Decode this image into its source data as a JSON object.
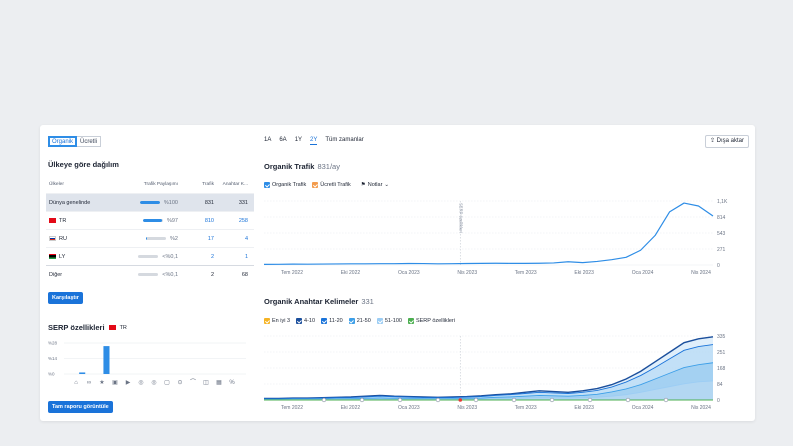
{
  "left": {
    "tabs": [
      {
        "label": "Organik",
        "active": true
      },
      {
        "label": "Ücretli",
        "active": false
      }
    ],
    "country_title": "Ülkeye göre dağılım",
    "table": {
      "headers": {
        "country": "Ülkeler",
        "share": "Trafik Paylaşımı",
        "traffic": "Trafik",
        "keywords": "Anahtar K..."
      },
      "rows": [
        {
          "country": "Dünya genelinde",
          "flag": "",
          "share": "%100",
          "share_level": 1.0,
          "traffic": "831",
          "keywords": "331",
          "selected": true
        },
        {
          "country": "TR",
          "flag": "tr",
          "share": "%97",
          "share_level": 0.97,
          "traffic": "810",
          "keywords": "258",
          "selected": false
        },
        {
          "country": "RU",
          "flag": "ru",
          "share": "%2",
          "share_level": 0.02,
          "traffic": "17",
          "keywords": "4",
          "selected": false
        },
        {
          "country": "LY",
          "flag": "ly",
          "share": "<%0,1",
          "share_level": 0.0,
          "traffic": "2",
          "keywords": "1",
          "selected": false
        },
        {
          "country": "Diğer",
          "flag": "",
          "share": "<%0,1",
          "share_level": 0.0,
          "traffic": "2",
          "keywords": "68",
          "selected": false
        }
      ]
    },
    "compare_button": "Karşılaştır",
    "serp": {
      "title": "SERP özellikleri",
      "country": "TR",
      "y_ticks": [
        "%28",
        "%14",
        "%0"
      ],
      "bars": [
        0,
        0.05,
        0,
        0.9,
        0,
        0,
        0,
        0,
        0,
        0,
        0,
        0,
        0,
        0,
        0
      ],
      "icons": [
        "home-icon",
        "link-icon",
        "star-icon",
        "image-icon",
        "video-icon",
        "circle-icon",
        "circle-icon",
        "chat-icon",
        "pin-icon",
        "graduation-icon",
        "shop-icon",
        "building-icon",
        "percent-icon"
      ]
    },
    "full_report_button": "Tam raporu görüntüle"
  },
  "right": {
    "periods": [
      {
        "label": "1A"
      },
      {
        "label": "6A"
      },
      {
        "label": "1Y"
      },
      {
        "label": "2Y",
        "active": true
      },
      {
        "label": "Tüm zamanlar"
      }
    ],
    "export_label": "Dışa aktar",
    "traffic": {
      "title": "Organik Trafik",
      "value": "831/ay",
      "legend": {
        "organic": "Organik Trafik",
        "paid": "Ücretli Trafik",
        "notes": "Notlar"
      }
    },
    "keywords": {
      "title": "Organik Anahtar Kelimeler",
      "value": "331",
      "legend": [
        {
          "label": "En iyi 3",
          "color": "#f5b324"
        },
        {
          "label": "4-10",
          "color": "#1b4f9c"
        },
        {
          "label": "11-20",
          "color": "#1a73d9"
        },
        {
          "label": "21-50",
          "color": "#3d9fe8"
        },
        {
          "label": "51-100",
          "color": "#9ccdf4"
        },
        {
          "label": "SERP özellikleri",
          "color": "#4caf50"
        }
      ]
    }
  },
  "colors": {
    "accent": "#1a73d9",
    "organic": "#2e8de6",
    "paid": "#f39c4d"
  },
  "chart_data": [
    {
      "type": "line",
      "title": "Organik Trafik",
      "x": [
        "Tem 2022",
        "Eki 2022",
        "Oca 2023",
        "Nis 2023",
        "Tem 2023",
        "Eki 2023",
        "Oca 2024",
        "Nis 2024"
      ],
      "y_ticks": [
        "1,1K",
        "814",
        "543",
        "271",
        "0"
      ],
      "ylim": [
        0,
        1085
      ],
      "annotation": "SERP özellikleri",
      "series": [
        {
          "name": "Organik Trafik",
          "values": [
            10,
            12,
            15,
            14,
            16,
            18,
            20,
            20,
            22,
            22,
            25,
            24,
            20,
            22,
            25,
            28,
            30,
            28,
            28,
            30,
            35,
            55,
            40,
            60,
            90,
            130,
            250,
            500,
            900,
            1050,
            1000,
            831
          ]
        }
      ]
    },
    {
      "type": "area",
      "title": "Organik Anahtar Kelimeler",
      "x": [
        "Tem 2022",
        "Eki 2022",
        "Oca 2023",
        "Nis 2023",
        "Tem 2023",
        "Eki 2023",
        "Oca 2024",
        "Nis 2024"
      ],
      "y_ticks": [
        "335",
        "251",
        "168",
        "84",
        "0"
      ],
      "ylim": [
        0,
        335
      ],
      "series": [
        {
          "name": "4-10",
          "values": [
            8,
            8,
            10,
            10,
            12,
            14,
            16,
            20,
            24,
            20,
            18,
            16,
            14,
            16,
            18,
            22,
            28,
            32,
            40,
            48,
            44,
            40,
            48,
            60,
            80,
            110,
            150,
            200,
            250,
            300,
            320,
            331
          ]
        },
        {
          "name": "11-20",
          "values": [
            6,
            6,
            8,
            8,
            10,
            12,
            13,
            16,
            20,
            17,
            15,
            13,
            12,
            13,
            15,
            18,
            24,
            28,
            34,
            40,
            37,
            34,
            40,
            50,
            68,
            94,
            128,
            170,
            215,
            260,
            280,
            290
          ]
        },
        {
          "name": "21-50",
          "values": [
            3,
            3,
            4,
            4,
            5,
            6,
            7,
            9,
            11,
            9,
            8,
            7,
            6,
            7,
            8,
            10,
            14,
            16,
            20,
            24,
            22,
            20,
            24,
            30,
            42,
            58,
            80,
            110,
            140,
            170,
            185,
            195
          ]
        },
        {
          "name": "51-100",
          "values": [
            1,
            1,
            2,
            2,
            2,
            3,
            3,
            4,
            5,
            4,
            4,
            3,
            3,
            3,
            4,
            5,
            7,
            8,
            10,
            12,
            11,
            10,
            12,
            15,
            20,
            28,
            40,
            55,
            70,
            85,
            95,
            100
          ]
        },
        {
          "name": "SERP özellikleri",
          "values": [
            0,
            0,
            0,
            0,
            0,
            0,
            0,
            0,
            0,
            0,
            0,
            0,
            0,
            0,
            0,
            0,
            0,
            0,
            0,
            0,
            0,
            0,
            0,
            0,
            0,
            0,
            0,
            0,
            0,
            0,
            0,
            0
          ]
        }
      ],
      "markers": 10
    }
  ]
}
